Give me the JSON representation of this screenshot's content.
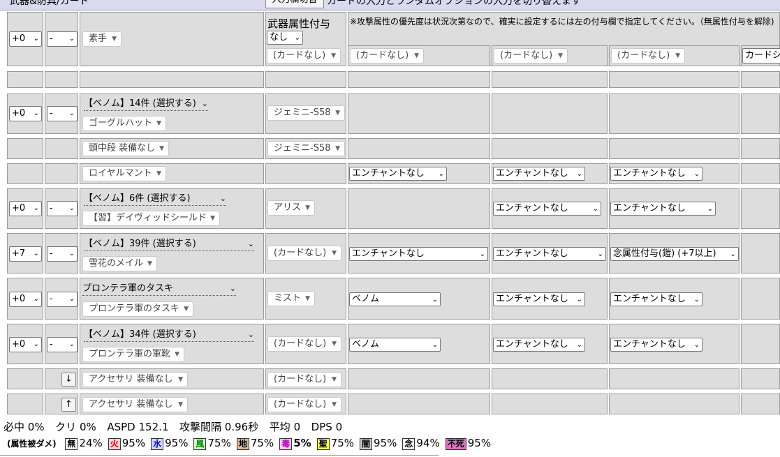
{
  "header": {
    "title": "武器&防具/カード",
    "toggle_button": "入力欄切替",
    "info": "カードの入力とランダムオプションの入力を切り替えます"
  },
  "weapon_row": {
    "refine": "+0",
    "slot": "-",
    "weapon": "素手",
    "element_label": "武器属性付与",
    "element_value": "なし",
    "note": "※攻撃属性の優先度は状況次第なので、確実に設定するには左の付与欄で指定してください。（無属性付与を解除)",
    "cards": [
      "(カードなし)",
      "(カードなし)",
      "(カードなし)",
      "(カードなし)"
    ],
    "card_partial": "カードシ"
  },
  "rows": [
    {
      "refine": "+0",
      "slot": "-",
      "set": "【ベノム】14件 (選択する)",
      "item": "ゴーグルハット",
      "card": "ジェミニ-S58",
      "enchants": []
    },
    {
      "refine": "",
      "slot": "",
      "set": "",
      "item": "頭中段 装備なし",
      "card": "ジェミニ-S58",
      "enchants": []
    },
    {
      "refine": "",
      "slot": "",
      "set": "",
      "item": "ロイヤルマント",
      "card": "",
      "enchants": [
        "エンチャントなし",
        "エンチャントなし",
        "エンチャントなし"
      ]
    },
    {
      "refine": "+0",
      "slot": "-",
      "set": "【ベノム】6件 (選択する)",
      "item": "【習】デイヴィッドシールド",
      "card": "アリス",
      "enchants": [
        "",
        "エンチャントなし",
        "エンチャントなし"
      ]
    },
    {
      "refine": "+7",
      "slot": "-",
      "set": "【ベノム】39件 (選択する)",
      "item": "雪花のメイル",
      "card": "(カードなし)",
      "enchants": [
        "エンチャントなし",
        "エンチャントなし",
        "念属性付与(鎧) (+7以上)"
      ]
    },
    {
      "refine": "+0",
      "slot": "-",
      "set": "プロンテラ軍のタスキ",
      "item": "プロンテラ軍のタスキ",
      "card": "ミスト",
      "enchants": [
        "ベノム",
        "エンチャントなし",
        "エンチャントなし"
      ]
    },
    {
      "refine": "+0",
      "slot": "-",
      "set": "【ベノム】34件 (選択する)",
      "item": "プロンテラ軍の軍靴",
      "card": "(カードなし)",
      "enchants": [
        "ベノム",
        "エンチャントなし",
        "エンチャントなし"
      ]
    },
    {
      "arrow": "↓",
      "item": "アクセサリ 装備なし",
      "card": "(カードなし)"
    },
    {
      "arrow": "↑",
      "item": "アクセサリ 装備なし",
      "card": "(カードなし)"
    }
  ],
  "stats": {
    "hit_label": "必中",
    "hit": "0%",
    "crit_label": "クリ",
    "crit": "0%",
    "aspd_label": "ASPD",
    "aspd": "152.1",
    "interval_label": "攻撃間隔",
    "interval": "0.96秒",
    "avg_label": "平均",
    "avg": "0",
    "dps_label": "DPS",
    "dps": "0"
  },
  "elements": {
    "label": "(属性被ダメ)",
    "items": [
      {
        "name": "無",
        "value": "24%",
        "bg": "#ffffff",
        "fg": "#000000"
      },
      {
        "name": "火",
        "value": "95%",
        "bg": "#ffd0d0",
        "fg": "#cc0000"
      },
      {
        "name": "水",
        "value": "95%",
        "bg": "#d0d8ff",
        "fg": "#0000cc"
      },
      {
        "name": "風",
        "value": "75%",
        "bg": "#d0ffd0",
        "fg": "#008800"
      },
      {
        "name": "地",
        "value": "75%",
        "bg": "#d8b89a",
        "fg": "#000000"
      },
      {
        "name": "毒",
        "value": "5%",
        "bg": "#ffc8ff",
        "fg": "#aa00aa"
      },
      {
        "name": "聖",
        "value": "75%",
        "bg": "#ffff60",
        "fg": "#000000"
      },
      {
        "name": "闇",
        "value": "95%",
        "bg": "#d0d0d0",
        "fg": "#000000"
      },
      {
        "name": "念",
        "value": "94%",
        "bg": "#ffffff",
        "fg": "#000000"
      },
      {
        "name": "不死",
        "value": "95%",
        "bg": "#e070c0",
        "fg": "#000000"
      }
    ]
  }
}
